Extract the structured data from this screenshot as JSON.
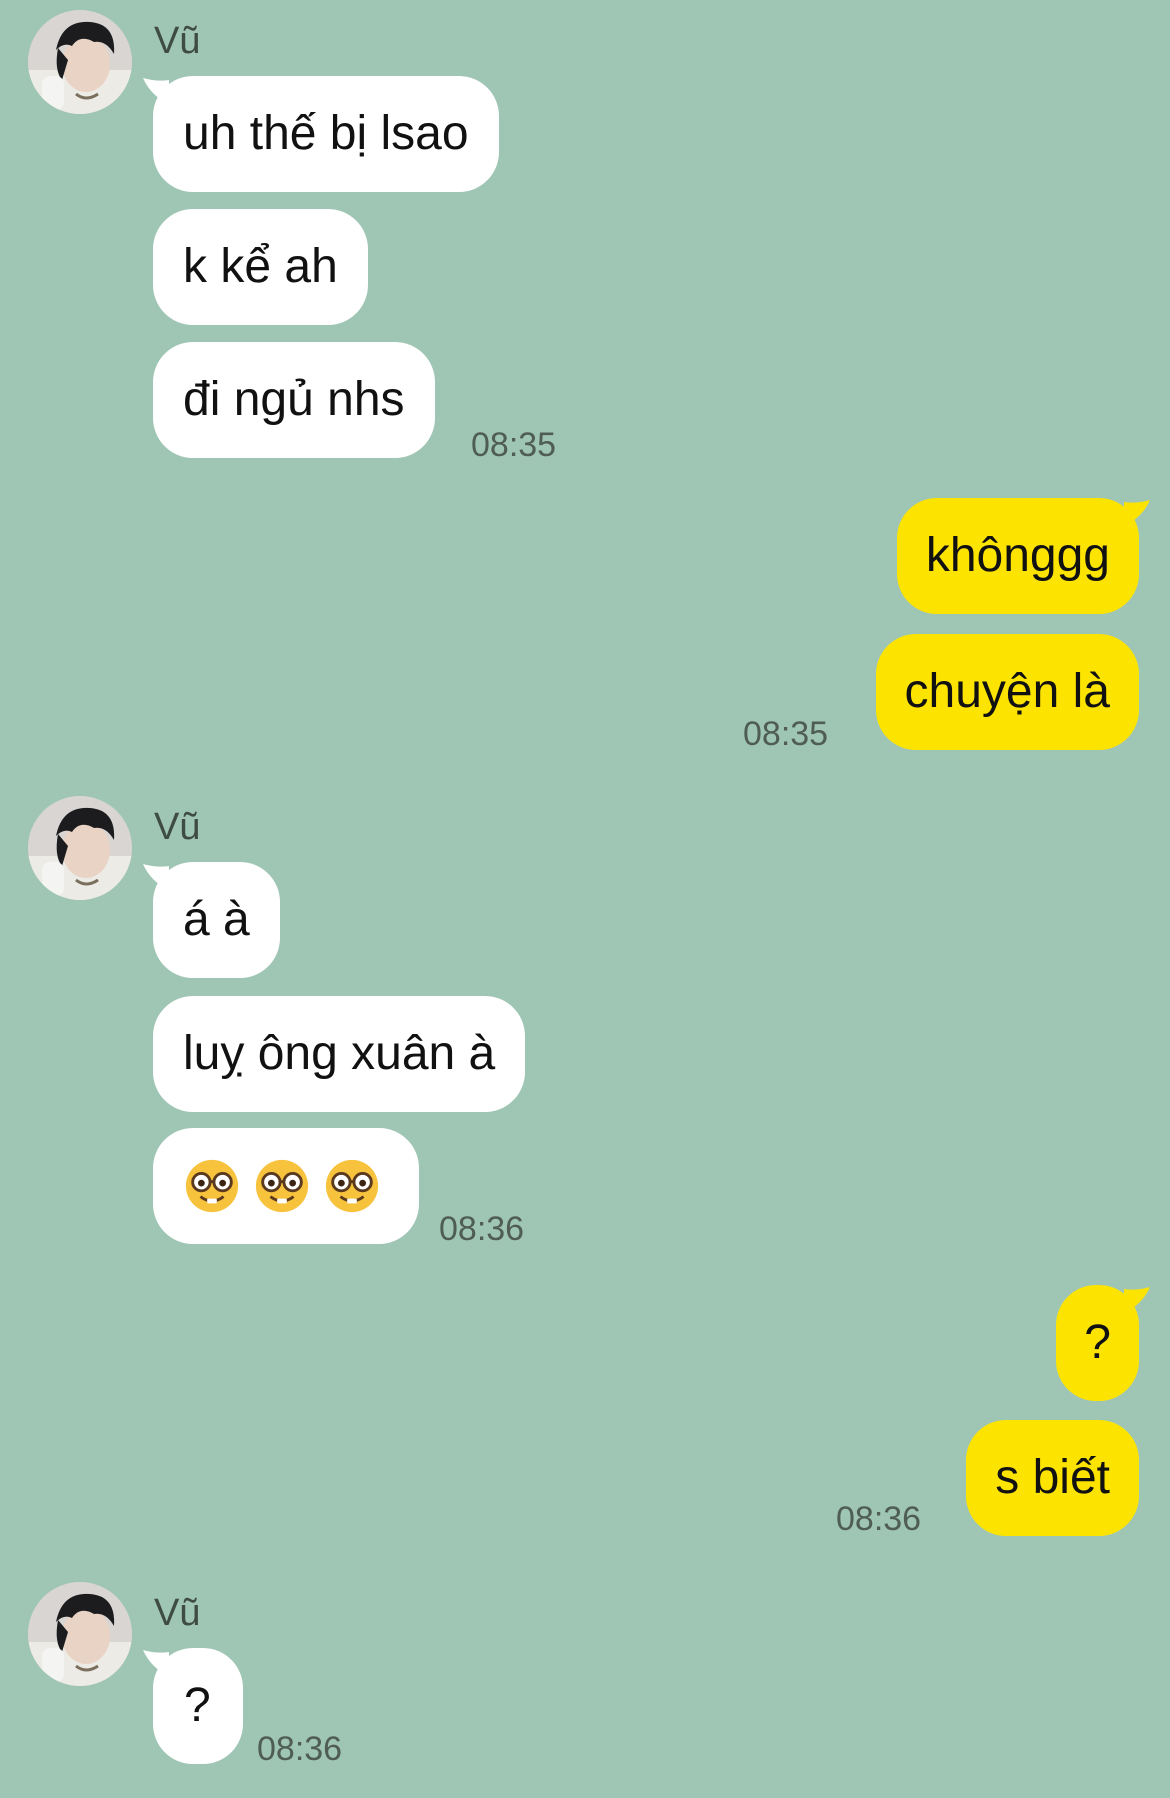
{
  "contact": {
    "name": "Vũ"
  },
  "conversation": [
    {
      "from": "contact",
      "sender": "Vũ",
      "messages": [
        "uh thế bị lsao",
        "k kể ah",
        "đi ngủ nhs"
      ],
      "time": "08:35"
    },
    {
      "from": "me",
      "messages": [
        "khônggg",
        "chuyện là"
      ],
      "time": "08:35"
    },
    {
      "from": "contact",
      "sender": "Vũ",
      "messages": [
        "á à",
        "luỵ ông xuân à",
        "🤓🤓🤓"
      ],
      "time": "08:36"
    },
    {
      "from": "me",
      "messages": [
        "?",
        "s biết"
      ],
      "time": "08:36"
    },
    {
      "from": "contact",
      "sender": "Vũ",
      "messages": [
        "?"
      ],
      "time": "08:36"
    }
  ],
  "icons": {
    "avatar": "profile-photo",
    "emoji": "nerd-face-emoji"
  },
  "colors": {
    "background": "#9fc6b5",
    "incoming_bubble": "#ffffff",
    "outgoing_bubble": "#fde400",
    "text": "#111111",
    "timestamp": "#4f5d56"
  }
}
